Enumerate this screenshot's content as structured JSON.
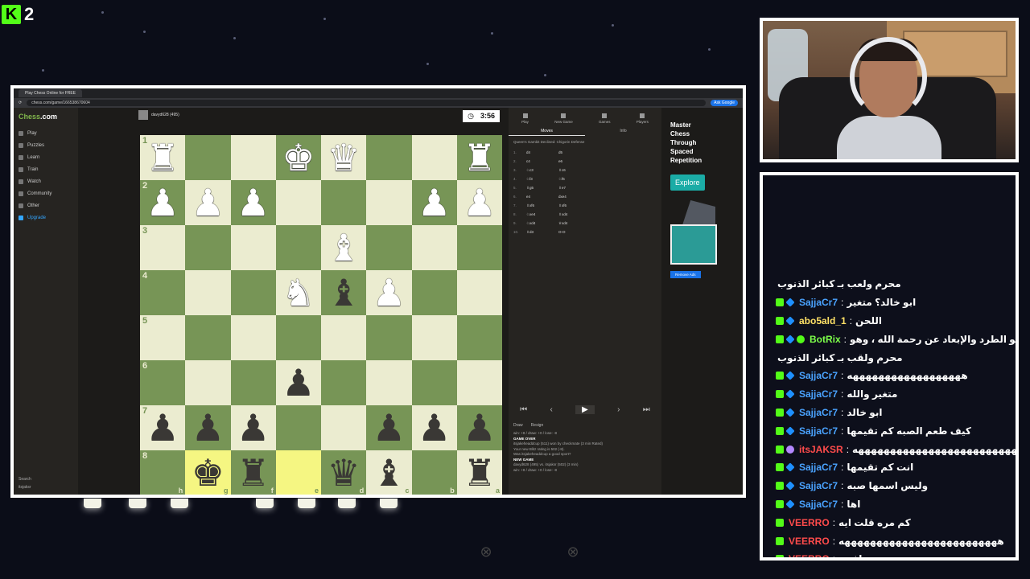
{
  "overlay": {
    "kick_count": "2",
    "kick_logo": "K"
  },
  "browser": {
    "tab_title": "Play Chess Online for FREE",
    "url": "chess.com/game/166538670604",
    "ask_google": "Ask Google"
  },
  "sidebar": {
    "logo_main": "Chess",
    "logo_suffix": ".com",
    "items": [
      {
        "label": "Play"
      },
      {
        "label": "Puzzles"
      },
      {
        "label": "Learn"
      },
      {
        "label": "Train"
      },
      {
        "label": "Watch"
      },
      {
        "label": "Community"
      },
      {
        "label": "Other"
      },
      {
        "label": "Upgrade"
      }
    ],
    "search": "Search",
    "user": "itsjaksr"
  },
  "game": {
    "opponent": "davyd628 (495)",
    "clock": "3:56",
    "ranks": [
      "1",
      "2",
      "3",
      "4",
      "5",
      "6",
      "7",
      "8"
    ],
    "files": [
      "h",
      "g",
      "f",
      "e",
      "d",
      "c",
      "b",
      "a"
    ],
    "board": [
      [
        "wr",
        "",
        "",
        "wk",
        "wq",
        "",
        "",
        "wr"
      ],
      [
        "wp",
        "wp",
        "wp",
        "",
        "",
        "",
        "wp",
        "wp"
      ],
      [
        "",
        "",
        "",
        "",
        "wb",
        "",
        "",
        ""
      ],
      [
        "",
        "",
        "",
        "wn",
        "bb",
        "wp",
        "",
        ""
      ],
      [
        "",
        "",
        "",
        "",
        "",
        "",
        "",
        ""
      ],
      [
        "",
        "",
        "",
        "bp",
        "",
        "",
        "",
        ""
      ],
      [
        "bp",
        "bp",
        "bp",
        "",
        "",
        "bp",
        "bp",
        "bp"
      ],
      [
        "",
        "bk",
        "br",
        "",
        "bq",
        "bb",
        "",
        "br"
      ]
    ],
    "highlight": [
      [
        7,
        1
      ],
      [
        7,
        3
      ]
    ]
  },
  "panel": {
    "nav": [
      {
        "label": "Play"
      },
      {
        "label": "New Game"
      },
      {
        "label": "Games"
      },
      {
        "label": "Players"
      }
    ],
    "tabs": [
      {
        "label": "Moves"
      },
      {
        "label": "Info"
      }
    ],
    "opening": "Queen's Gambit Declined: Chigorin Defense",
    "moves": [
      {
        "no": "1.",
        "w": "d4",
        "b": "d5"
      },
      {
        "no": "2.",
        "w": "c4",
        "b": "e6"
      },
      {
        "no": "3.",
        "w": "♘c3",
        "b": "♗c6"
      },
      {
        "no": "4.",
        "w": "♘f3",
        "b": "♘f6"
      },
      {
        "no": "5.",
        "w": "♗g5",
        "b": "♗e7"
      },
      {
        "no": "6.",
        "w": "e4",
        "b": "dxe4"
      },
      {
        "no": "7.",
        "w": "♗xf6",
        "b": "♗xf6"
      },
      {
        "no": "8.",
        "w": "♘xe4",
        "b": "♗xd4"
      },
      {
        "no": "9.",
        "w": "♘xd4",
        "b": "♕xd4"
      },
      {
        "no": "10.",
        "w": "♗d3",
        "b": "O-O"
      }
    ],
    "draw": "Draw",
    "resign": "Resign",
    "result_stats": "win: +8 / draw: +0 / lose: -8",
    "game_over": "GAME OVER",
    "result_line": "itsjakeheaddcup (511) won by checkmate (3 min Rated)",
    "rating_line": "Your new Blitz rating is 502 (-8).",
    "good_sport": "Was itsjakeheaddcup a good sport?",
    "new_game": "NEW GAME",
    "new_game_line": "davyd628 (495) vs. itsjaksr (502) (3 min)",
    "new_game_stats": "win: +8 / draw: +0 / lose: -8"
  },
  "ad": {
    "title_lines": [
      "Master",
      "Chess",
      "Through",
      "Spaced",
      "Repetition"
    ],
    "explore": "Explore",
    "remove_ads": "Remove Ads"
  },
  "chat": {
    "messages": [
      {
        "kind": "cont",
        "text": "محرم ولعب بـ كبائر الذنوب"
      },
      {
        "user": "SajjaCr7",
        "color": "#4aa3ff",
        "badges": [
          "k",
          "v"
        ],
        "text": "ابو خالد؟ متغير"
      },
      {
        "user": "abo5ald_1",
        "color": "#ffe066",
        "badges": [
          "k",
          "v"
        ],
        "text": "اللحن"
      },
      {
        "user": "BotRix",
        "color": "#7dff4a",
        "badges": [
          "k",
          "v",
          "g"
        ],
        "text": "اللحن في الإسلام هو الطرد والإبعاد عن رحمة الله ، وهو"
      },
      {
        "kind": "cont",
        "text": "محرم ولقب بـ كبائر الذنوب"
      },
      {
        "user": "SajjaCr7",
        "color": "#4aa3ff",
        "badges": [
          "k",
          "v"
        ],
        "text": "ههههههههههههههههههه"
      },
      {
        "user": "SajjaCr7",
        "color": "#4aa3ff",
        "badges": [
          "k",
          "v"
        ],
        "text": "متغير والله"
      },
      {
        "user": "SajjaCr7",
        "color": "#4aa3ff",
        "badges": [
          "k",
          "v"
        ],
        "text": "ابو خالد"
      },
      {
        "user": "SajjaCr7",
        "color": "#4aa3ff",
        "badges": [
          "k",
          "v"
        ],
        "text": "كيف طعم الصبه كم تقيمها"
      },
      {
        "user": "itsJAKSR",
        "color": "#ff4b4b",
        "badges": [
          "k",
          "m"
        ],
        "text": "ههههههههههههههههههههههههههههههههههههه"
      },
      {
        "user": "SajjaCr7",
        "color": "#4aa3ff",
        "badges": [
          "k",
          "v"
        ],
        "text": "انت كم تقيمها"
      },
      {
        "user": "SajjaCr7",
        "color": "#4aa3ff",
        "badges": [
          "k",
          "v"
        ],
        "text": "وليس اسمها صبه"
      },
      {
        "user": "SajjaCr7",
        "color": "#4aa3ff",
        "badges": [
          "k",
          "v"
        ],
        "text": "اها"
      },
      {
        "user": "VEERRO",
        "color": "#ff4b4b",
        "badges": [
          "k"
        ],
        "text": "كم مره قلت ايه"
      },
      {
        "user": "VEERRO",
        "color": "#ff4b4b",
        "badges": [
          "k"
        ],
        "text": "هههههههههههههههههههههههههه"
      },
      {
        "user": "VEERRO",
        "color": "#ff4b4b",
        "badges": [
          "k"
        ],
        "text": "ههههههههههههههههههه مافهم"
      }
    ]
  }
}
